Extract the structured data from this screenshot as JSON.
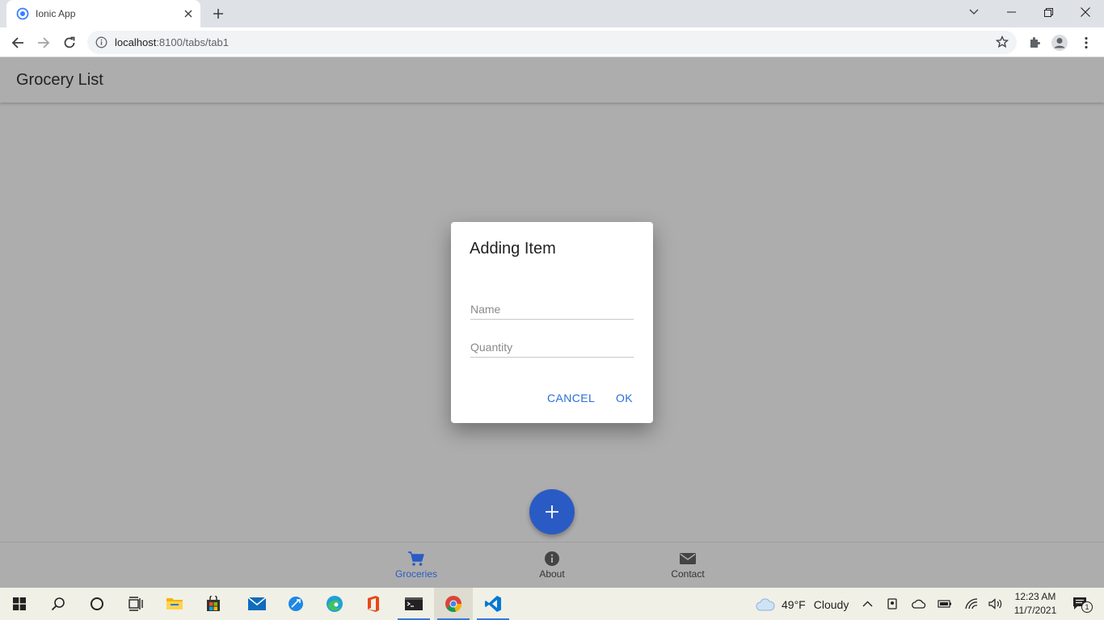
{
  "browser": {
    "tab_title": "Ionic App",
    "url_host": "localhost",
    "url_path": ":8100/tabs/tab1"
  },
  "app": {
    "title": "Grocery List",
    "accent": "#2a5bc4"
  },
  "dialog": {
    "title": "Adding Item",
    "name_placeholder": "Name",
    "quantity_placeholder": "Quantity",
    "cancel_label": "CANCEL",
    "ok_label": "OK"
  },
  "tabs": [
    {
      "label": "Groceries",
      "icon": "cart-icon",
      "active": true
    },
    {
      "label": "About",
      "icon": "info-icon",
      "active": false
    },
    {
      "label": "Contact",
      "icon": "mail-icon",
      "active": false
    }
  ],
  "taskbar": {
    "weather_temp": "49°F",
    "weather_condition": "Cloudy",
    "time": "12:23 AM",
    "date": "11/7/2021",
    "notification_count": "1"
  }
}
